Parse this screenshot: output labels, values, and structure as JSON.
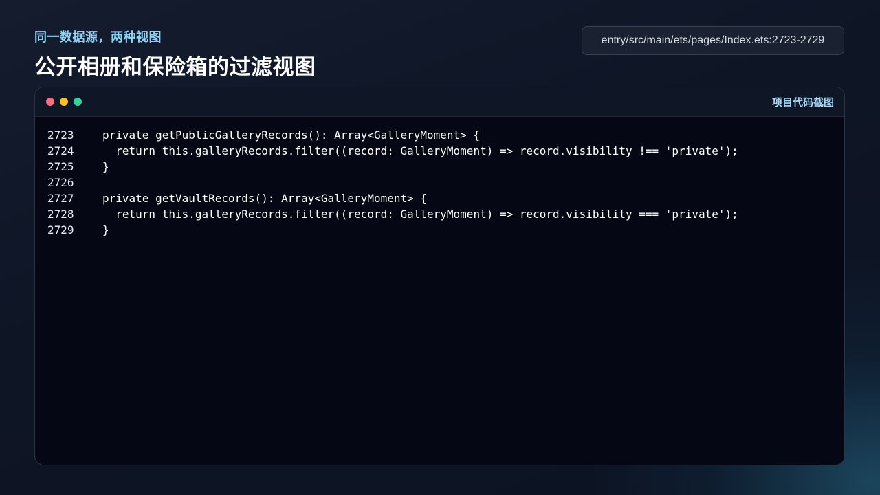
{
  "header": {
    "subtitle": "同一数据源，两种视图",
    "title": "公开相册和保险箱的过滤视图",
    "file_path": "entry/src/main/ets/pages/Index.ets:2723-2729"
  },
  "code_window": {
    "label": "项目代码截图",
    "traffic_lights": {
      "close_color": "#ff6b81",
      "minimize_color": "#fbbf24",
      "maximize_color": "#34d399"
    },
    "lines": [
      {
        "number": "2723",
        "text": "private getPublicGalleryRecords(): Array<GalleryMoment> {"
      },
      {
        "number": "2724",
        "text": "  return this.galleryRecords.filter((record: GalleryMoment) => record.visibility !== 'private');"
      },
      {
        "number": "2725",
        "text": "}"
      },
      {
        "number": "2726",
        "text": ""
      },
      {
        "number": "2727",
        "text": "private getVaultRecords(): Array<GalleryMoment> {"
      },
      {
        "number": "2728",
        "text": "  return this.galleryRecords.filter((record: GalleryMoment) => record.visibility === 'private');"
      },
      {
        "number": "2729",
        "text": "}"
      }
    ]
  }
}
